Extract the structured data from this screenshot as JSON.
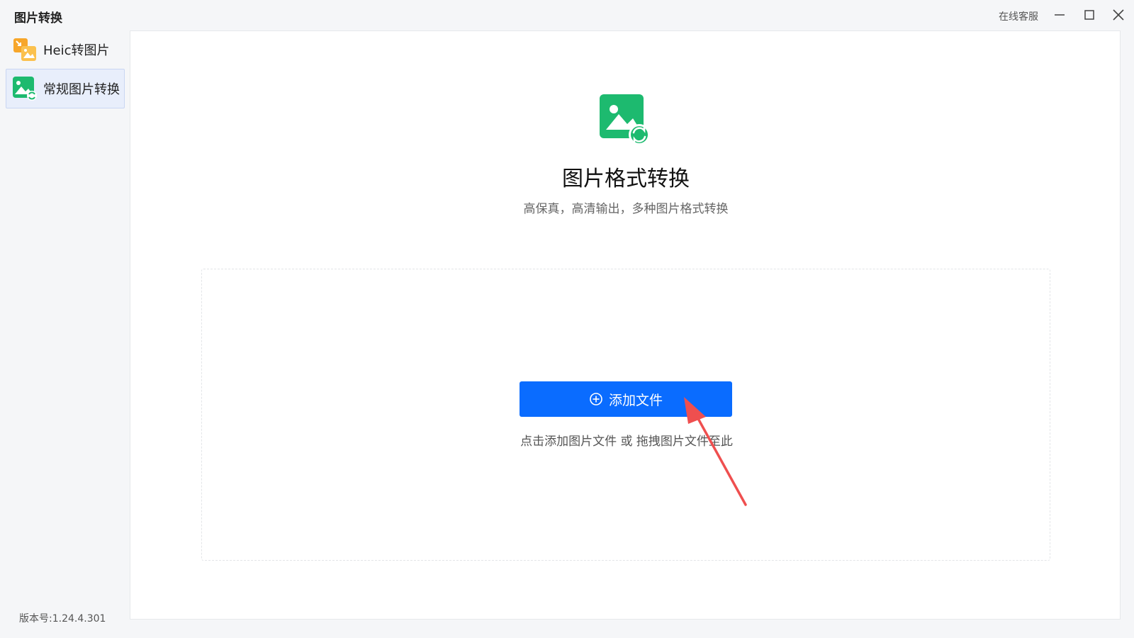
{
  "window": {
    "title": "图片转换",
    "service_label": "在线客服"
  },
  "sidebar": {
    "items": [
      {
        "label": "Heic转图片",
        "icon": "heic-convert-icon"
      },
      {
        "label": "常规图片转换",
        "icon": "image-convert-icon",
        "active": true
      }
    ],
    "version": "版本号:1.24.4.301"
  },
  "main": {
    "title": "图片格式转换",
    "subtitle": "高保真，高清输出，多种图片格式转换",
    "add_button": "添加文件",
    "drop_hint": "点击添加图片文件 或 拖拽图片文件至此"
  },
  "colors": {
    "accent": "#0a6cff",
    "green": "#1dba6f",
    "orange": "#f7a62a",
    "annotation_arrow": "#ef4f4f"
  }
}
